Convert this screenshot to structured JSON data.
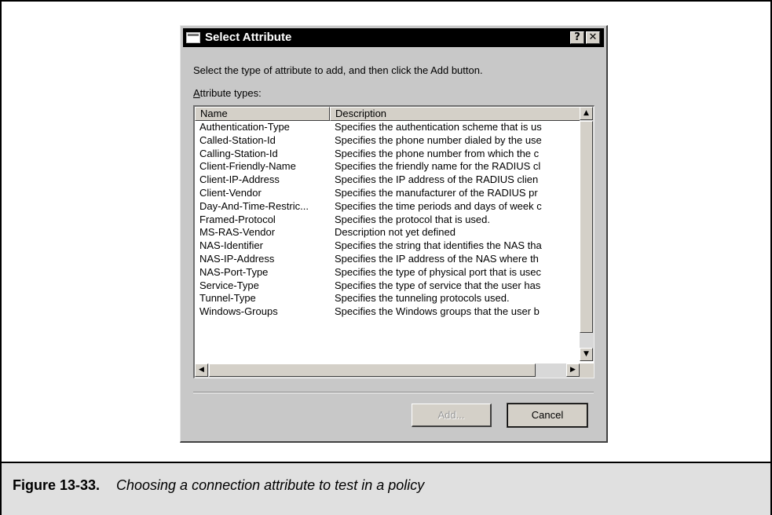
{
  "dialog": {
    "title": "Select Attribute",
    "help_glyph": "?",
    "close_glyph": "✕",
    "instruction": "Select the type of attribute to add, and then click the Add button.",
    "attr_label_access": "A",
    "attr_label_rest": "ttribute types:",
    "columns": {
      "name": "Name",
      "description": "Description"
    },
    "rows": [
      {
        "name": "Authentication-Type",
        "description": "Specifies the authentication scheme that is us"
      },
      {
        "name": "Called-Station-Id",
        "description": "Specifies the phone number dialed by the use"
      },
      {
        "name": "Calling-Station-Id",
        "description": "Specifies the phone number from which the c"
      },
      {
        "name": "Client-Friendly-Name",
        "description": "Specifies the friendly name for the RADIUS cl"
      },
      {
        "name": "Client-IP-Address",
        "description": "Specifies the IP address of the RADIUS clien"
      },
      {
        "name": "Client-Vendor",
        "description": "Specifies the manufacturer of the RADIUS pr"
      },
      {
        "name": "Day-And-Time-Restric...",
        "description": "Specifies the time periods and days of week c"
      },
      {
        "name": "Framed-Protocol",
        "description": "Specifies the protocol that is used."
      },
      {
        "name": "MS-RAS-Vendor",
        "description": "Description not yet defined"
      },
      {
        "name": "NAS-Identifier",
        "description": "Specifies the string that identifies the NAS tha"
      },
      {
        "name": "NAS-IP-Address",
        "description": "Specifies the IP address of the NAS where th"
      },
      {
        "name": "NAS-Port-Type",
        "description": "Specifies the type of physical port that is usec"
      },
      {
        "name": "Service-Type",
        "description": "Specifies the type of service that the user has"
      },
      {
        "name": "Tunnel-Type",
        "description": "Specifies the tunneling protocols used."
      },
      {
        "name": "Windows-Groups",
        "description": "Specifies the Windows groups that the user b"
      }
    ],
    "add_button": "Add...",
    "cancel_button": "Cancel"
  },
  "figure": {
    "label": "Figure 13-33.",
    "caption": "Choosing a connection attribute to test in a policy"
  },
  "icons": {
    "scroll_up": "▲",
    "scroll_down": "▼",
    "scroll_left": "◀",
    "scroll_right": "▶"
  }
}
